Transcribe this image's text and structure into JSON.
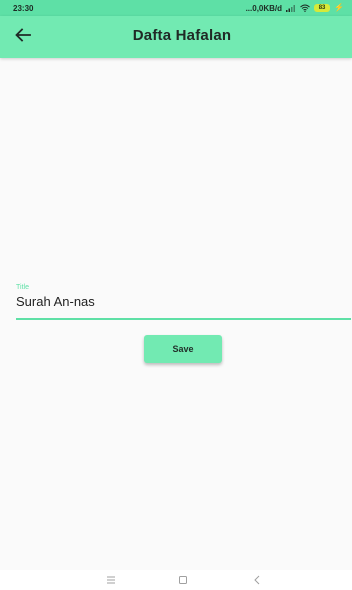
{
  "status_bar": {
    "time": "23:30",
    "network": "...0,0KB/d",
    "battery": "83",
    "icons": [
      "signal-icon",
      "wifi-icon",
      "battery-icon",
      "bolt-icon"
    ]
  },
  "app_bar": {
    "title": "Dafta Hafalan",
    "back_icon": "arrow-left-icon"
  },
  "form": {
    "title_label": "Title",
    "title_value": "Surah An-nas",
    "save_label": "Save"
  },
  "nav_bar": {
    "icons": [
      "menu-icon",
      "home-square-icon",
      "back-chevron-icon"
    ]
  },
  "colors": {
    "accent": "#72eab2",
    "status": "#5ee0a6",
    "background": "#fafafa"
  }
}
